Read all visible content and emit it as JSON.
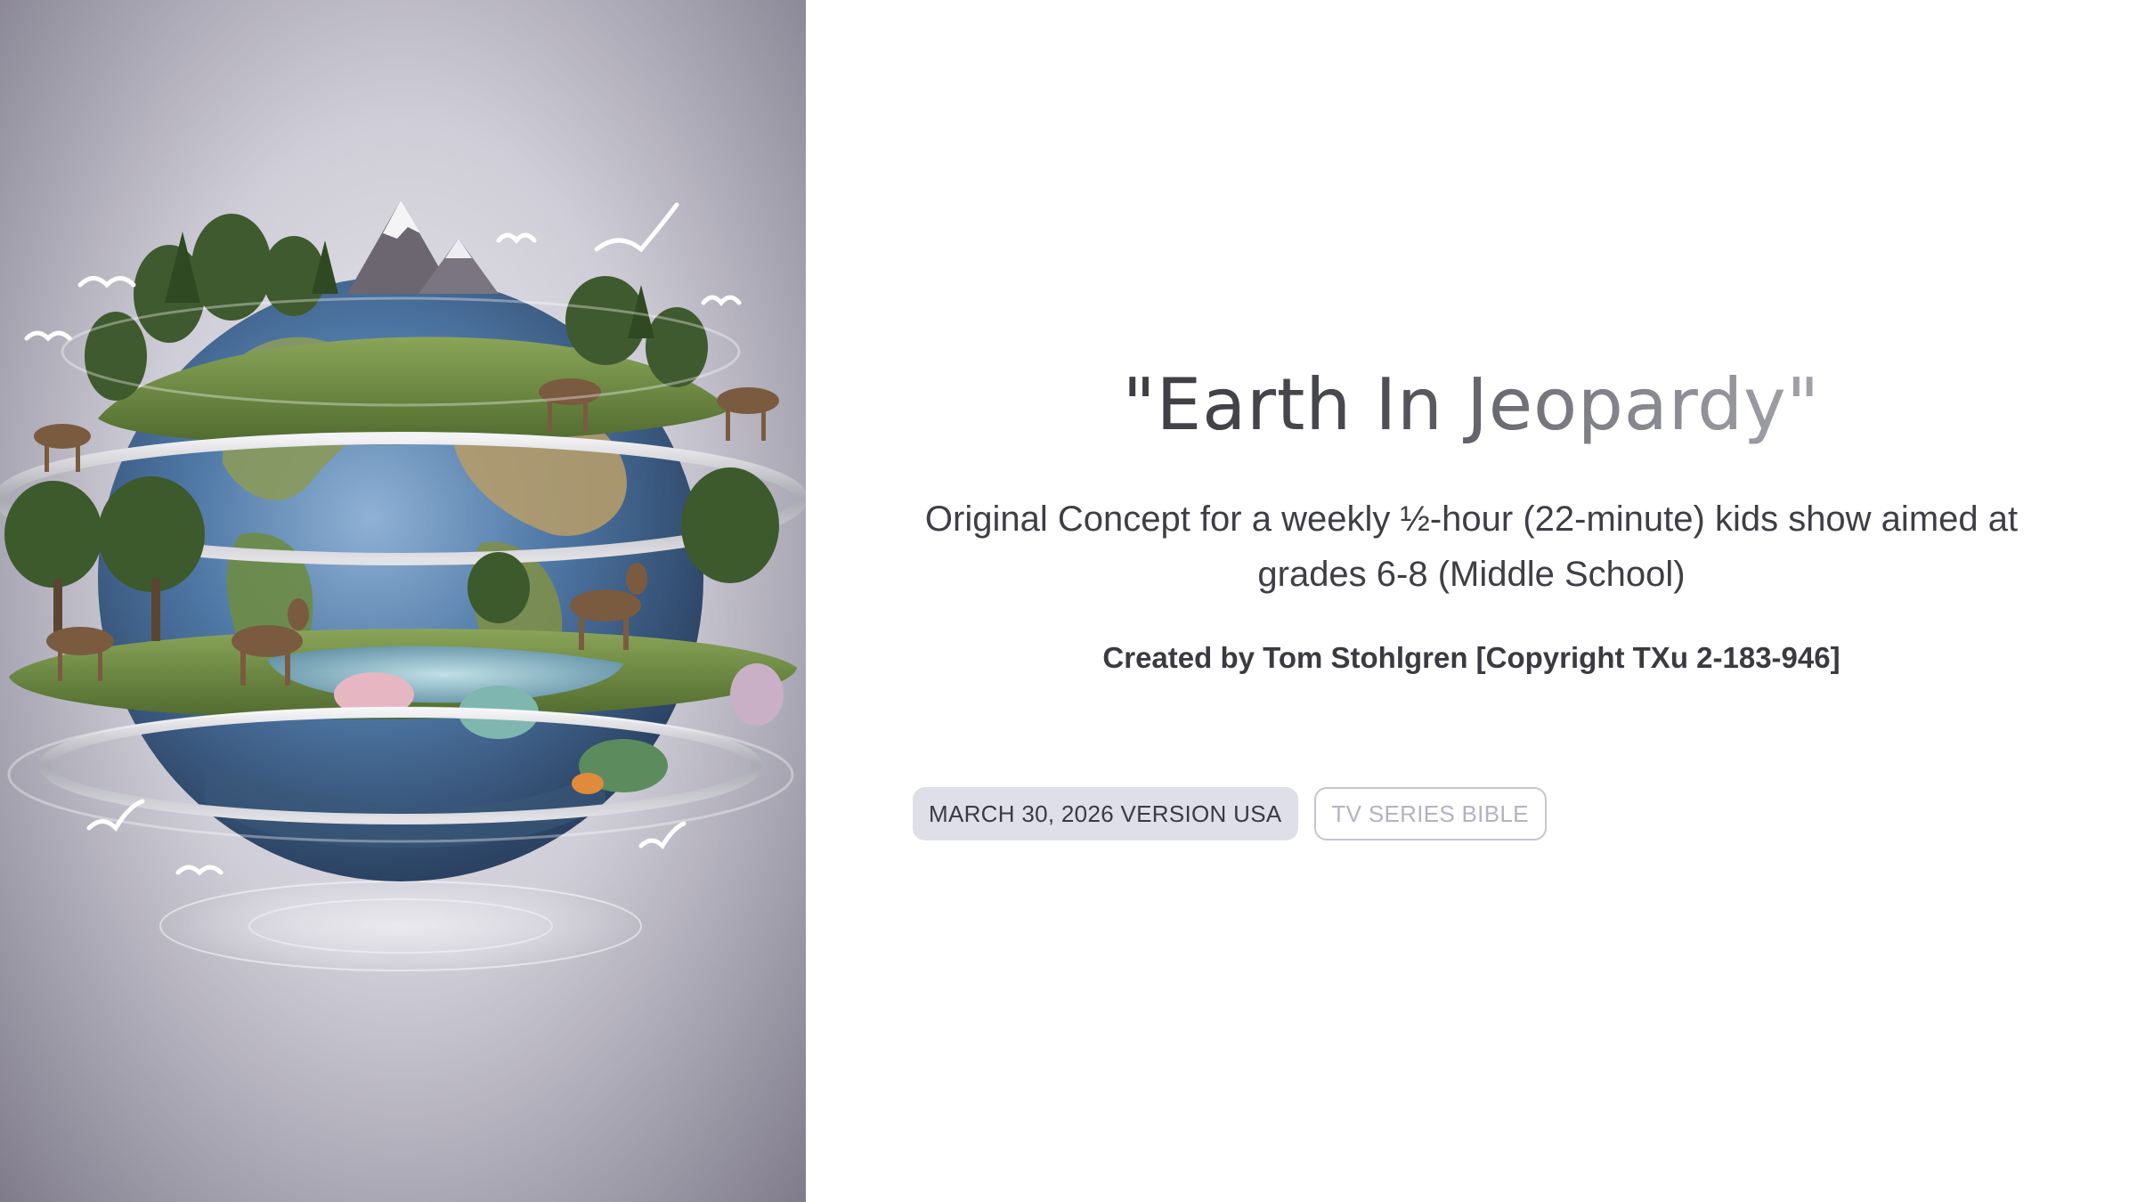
{
  "slide": {
    "title": "\"Earth In Jeopardy\"",
    "subtitle": "Original Concept for a weekly ½-hour (22-minute) kids show aimed at grades 6-8 (Middle School)",
    "credit": "Created by Tom Stohlgren [Copyright TXu 2-183-946]",
    "badges": {
      "date_version": "MARCH 30, 2026 VERSION USA",
      "doc_type": "TV SERIES BIBLE"
    }
  },
  "image": {
    "icon": "earth-ecosystem-globe-illustration"
  },
  "colors": {
    "title": "#4a4a51",
    "badge_fill": "#dfdfe9",
    "badge_outline": "#c5c5d2",
    "panel_bg": "#b9b7c3"
  }
}
